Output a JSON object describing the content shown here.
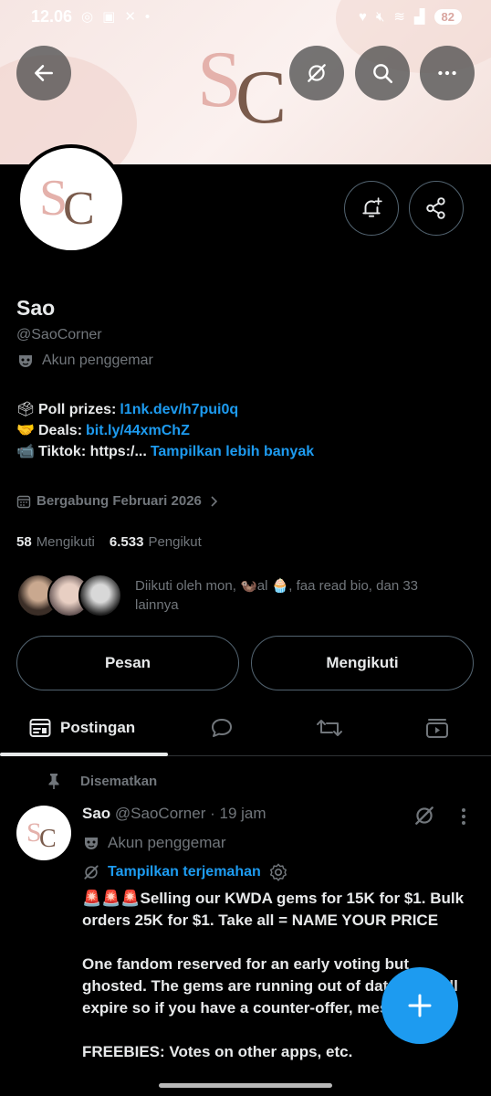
{
  "status_bar": {
    "time": "12.06",
    "battery": "82"
  },
  "profile": {
    "name": "Sao",
    "handle": "@SaoCorner",
    "category": "Akun penggemar",
    "logo_text": "SC",
    "bio": {
      "line1_emoji": "🗳",
      "line1_label": "Poll prizes: ",
      "line1_link": "l1nk.dev/h7pui0q",
      "line2_emoji": "🤝",
      "line2_label": "Deals: ",
      "line2_link": "bit.ly/44xmChZ",
      "line3_emoji": "📹",
      "line3_label": "Tiktok: https:/... ",
      "line3_more": "Tampilkan lebih banyak"
    },
    "joined": "Bergabung Februari 2026",
    "following_count": "58",
    "following_label": "Mengikuti",
    "followers_count": "6.533",
    "followers_label": "Pengikut",
    "followed_by": "Diikuti oleh mon, 🦦al 🧁, faa read bio, dan 33 lainnya"
  },
  "buttons": {
    "message": "Pesan",
    "following": "Mengikuti"
  },
  "tabs": {
    "posts": "Postingan"
  },
  "post": {
    "pinned_label": "Disematkan",
    "author_name": "Sao",
    "author_meta": " @SaoCorner · 19 jam",
    "category": "Akun penggemar",
    "translate": "Tampilkan terjemahan",
    "para1": "🚨🚨🚨Selling our KWDA gems for 15K for $1. Bulk orders 25K for $1. Take all = NAME YOUR PRICE",
    "para2": "One fandom reserved for an early voting but ghosted. The gems are running out of date and will expire so if you have a counter-offer, message us!",
    "para3": "FREEBIES: Votes on other apps, etc."
  },
  "colors": {
    "accent": "#1d9bf0",
    "background": "#000000",
    "muted": "#71767b",
    "text": "#e7e9ea",
    "banner": "#f6e6e3"
  },
  "icons": [
    "back-arrow-icon",
    "grok-icon",
    "search-icon",
    "more-icon",
    "bell-plus-icon",
    "share-icon",
    "mask-icon",
    "calendar-icon",
    "chevron-right-icon",
    "pin-icon",
    "gear-icon",
    "plus-icon"
  ]
}
